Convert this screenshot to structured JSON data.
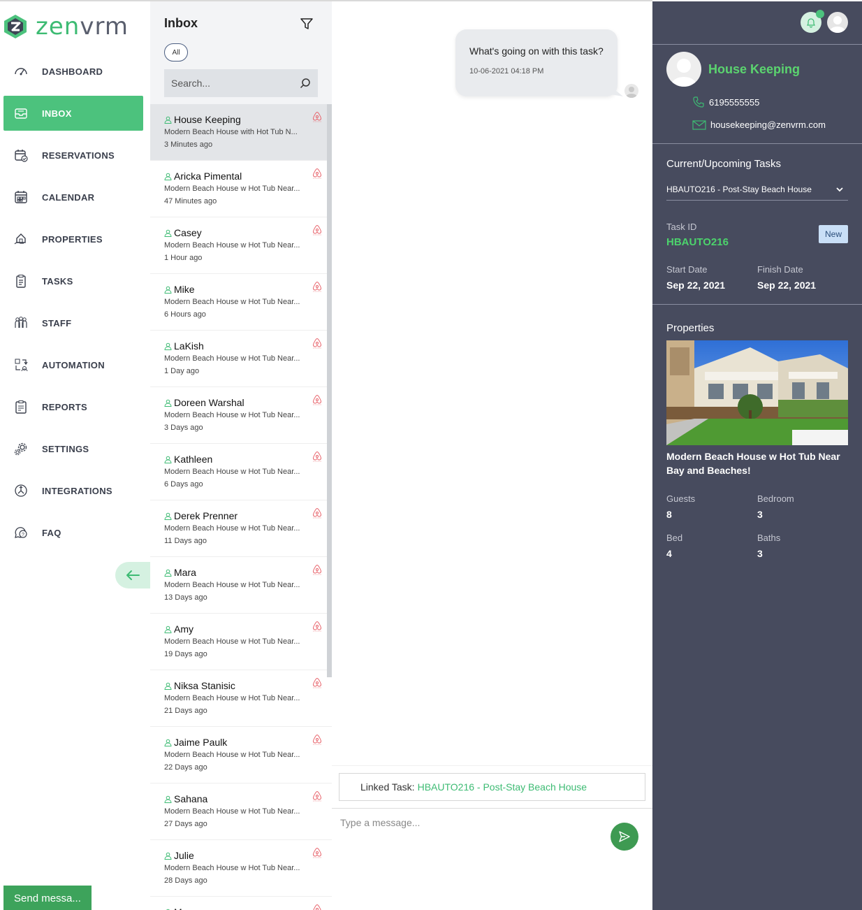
{
  "brand": {
    "name_prefix": "zen",
    "name_suffix": "vrm",
    "accent": "#4cc27d"
  },
  "sidebar": {
    "items": [
      {
        "label": "DASHBOARD",
        "icon": "speedometer-icon"
      },
      {
        "label": "INBOX",
        "icon": "inbox-icon",
        "active": true
      },
      {
        "label": "RESERVATIONS",
        "icon": "calendar-check-icon"
      },
      {
        "label": "CALENDAR",
        "icon": "calendar-icon"
      },
      {
        "label": "PROPERTIES",
        "icon": "house-hand-icon"
      },
      {
        "label": "TASKS",
        "icon": "clipboard-icon"
      },
      {
        "label": "STAFF",
        "icon": "people-icon"
      },
      {
        "label": "AUTOMATION",
        "icon": "automation-icon"
      },
      {
        "label": "REPORTS",
        "icon": "report-icon"
      },
      {
        "label": "SETTINGS",
        "icon": "gears-icon"
      },
      {
        "label": "INTEGRATIONS",
        "icon": "integrations-icon"
      },
      {
        "label": "FAQ",
        "icon": "faq-icon"
      }
    ],
    "collapse_icon": "arrow-left-icon",
    "send_message_label": "Send messa..."
  },
  "inbox": {
    "title": "Inbox",
    "filter_pill": "All",
    "search_placeholder": "Search...",
    "conversations": [
      {
        "name": "House Keeping",
        "property": "Modern Beach House with Hot Tub N...",
        "time": "3 Minutes ago",
        "active": true
      },
      {
        "name": "Aricka Pimental",
        "property": "Modern Beach House w Hot Tub Near...",
        "time": "47 Minutes ago"
      },
      {
        "name": "Casey",
        "property": "Modern Beach House w Hot Tub Near...",
        "time": "1 Hour ago"
      },
      {
        "name": "Mike",
        "property": "Modern Beach House w Hot Tub Near...",
        "time": "6 Hours ago"
      },
      {
        "name": "LaKish",
        "property": "Modern Beach House w Hot Tub Near...",
        "time": "1 Day ago"
      },
      {
        "name": "Doreen Warshal",
        "property": "Modern Beach House w Hot Tub Near...",
        "time": "3 Days ago"
      },
      {
        "name": "Kathleen",
        "property": "Modern Beach House w Hot Tub Near...",
        "time": "6 Days ago"
      },
      {
        "name": "Derek Prenner",
        "property": "Modern Beach House w Hot Tub Near...",
        "time": "11 Days ago"
      },
      {
        "name": "Mara",
        "property": "Modern Beach House w Hot Tub Near...",
        "time": "13 Days ago"
      },
      {
        "name": "Amy",
        "property": "Modern Beach House w Hot Tub Near...",
        "time": "19 Days ago"
      },
      {
        "name": "Niksa Stanisic",
        "property": "Modern Beach House w Hot Tub Near...",
        "time": "21 Days ago"
      },
      {
        "name": "Jaime Paulk",
        "property": "Modern Beach House w Hot Tub Near...",
        "time": "22 Days ago"
      },
      {
        "name": "Sahana",
        "property": "Modern Beach House w Hot Tub Near...",
        "time": "27 Days ago"
      },
      {
        "name": "Julie",
        "property": "Modern Beach House w Hot Tub Near...",
        "time": "28 Days ago"
      },
      {
        "name": "Megan",
        "property": "",
        "time": ""
      }
    ]
  },
  "chat": {
    "message_text": "What's going on with this task?",
    "message_time": "10-06-2021 04:18 PM",
    "linked_label": "Linked Task:",
    "linked_task": "HBAUTO216 - Post-Stay Beach House",
    "input_placeholder": "Type a message..."
  },
  "panel": {
    "contact_name": "House Keeping",
    "phone": "6195555555",
    "email": "housekeeping@zenvrm.com",
    "tasks_title": "Current/Upcoming Tasks",
    "task_selected": "HBAUTO216 - Post-Stay Beach House",
    "task_id_label": "Task ID",
    "task_id": "HBAUTO216",
    "status": "New",
    "start_label": "Start Date",
    "start_value": "Sep 22, 2021",
    "finish_label": "Finish Date",
    "finish_value": "Sep 22, 2021",
    "properties_title": "Properties",
    "property_name": "Modern Beach House w Hot Tub Near Bay and Beaches!",
    "guests_label": "Guests",
    "guests": "8",
    "bedroom_label": "Bedroom",
    "bedroom": "3",
    "bed_label": "Bed",
    "bed": "4",
    "baths_label": "Baths",
    "baths": "3"
  }
}
